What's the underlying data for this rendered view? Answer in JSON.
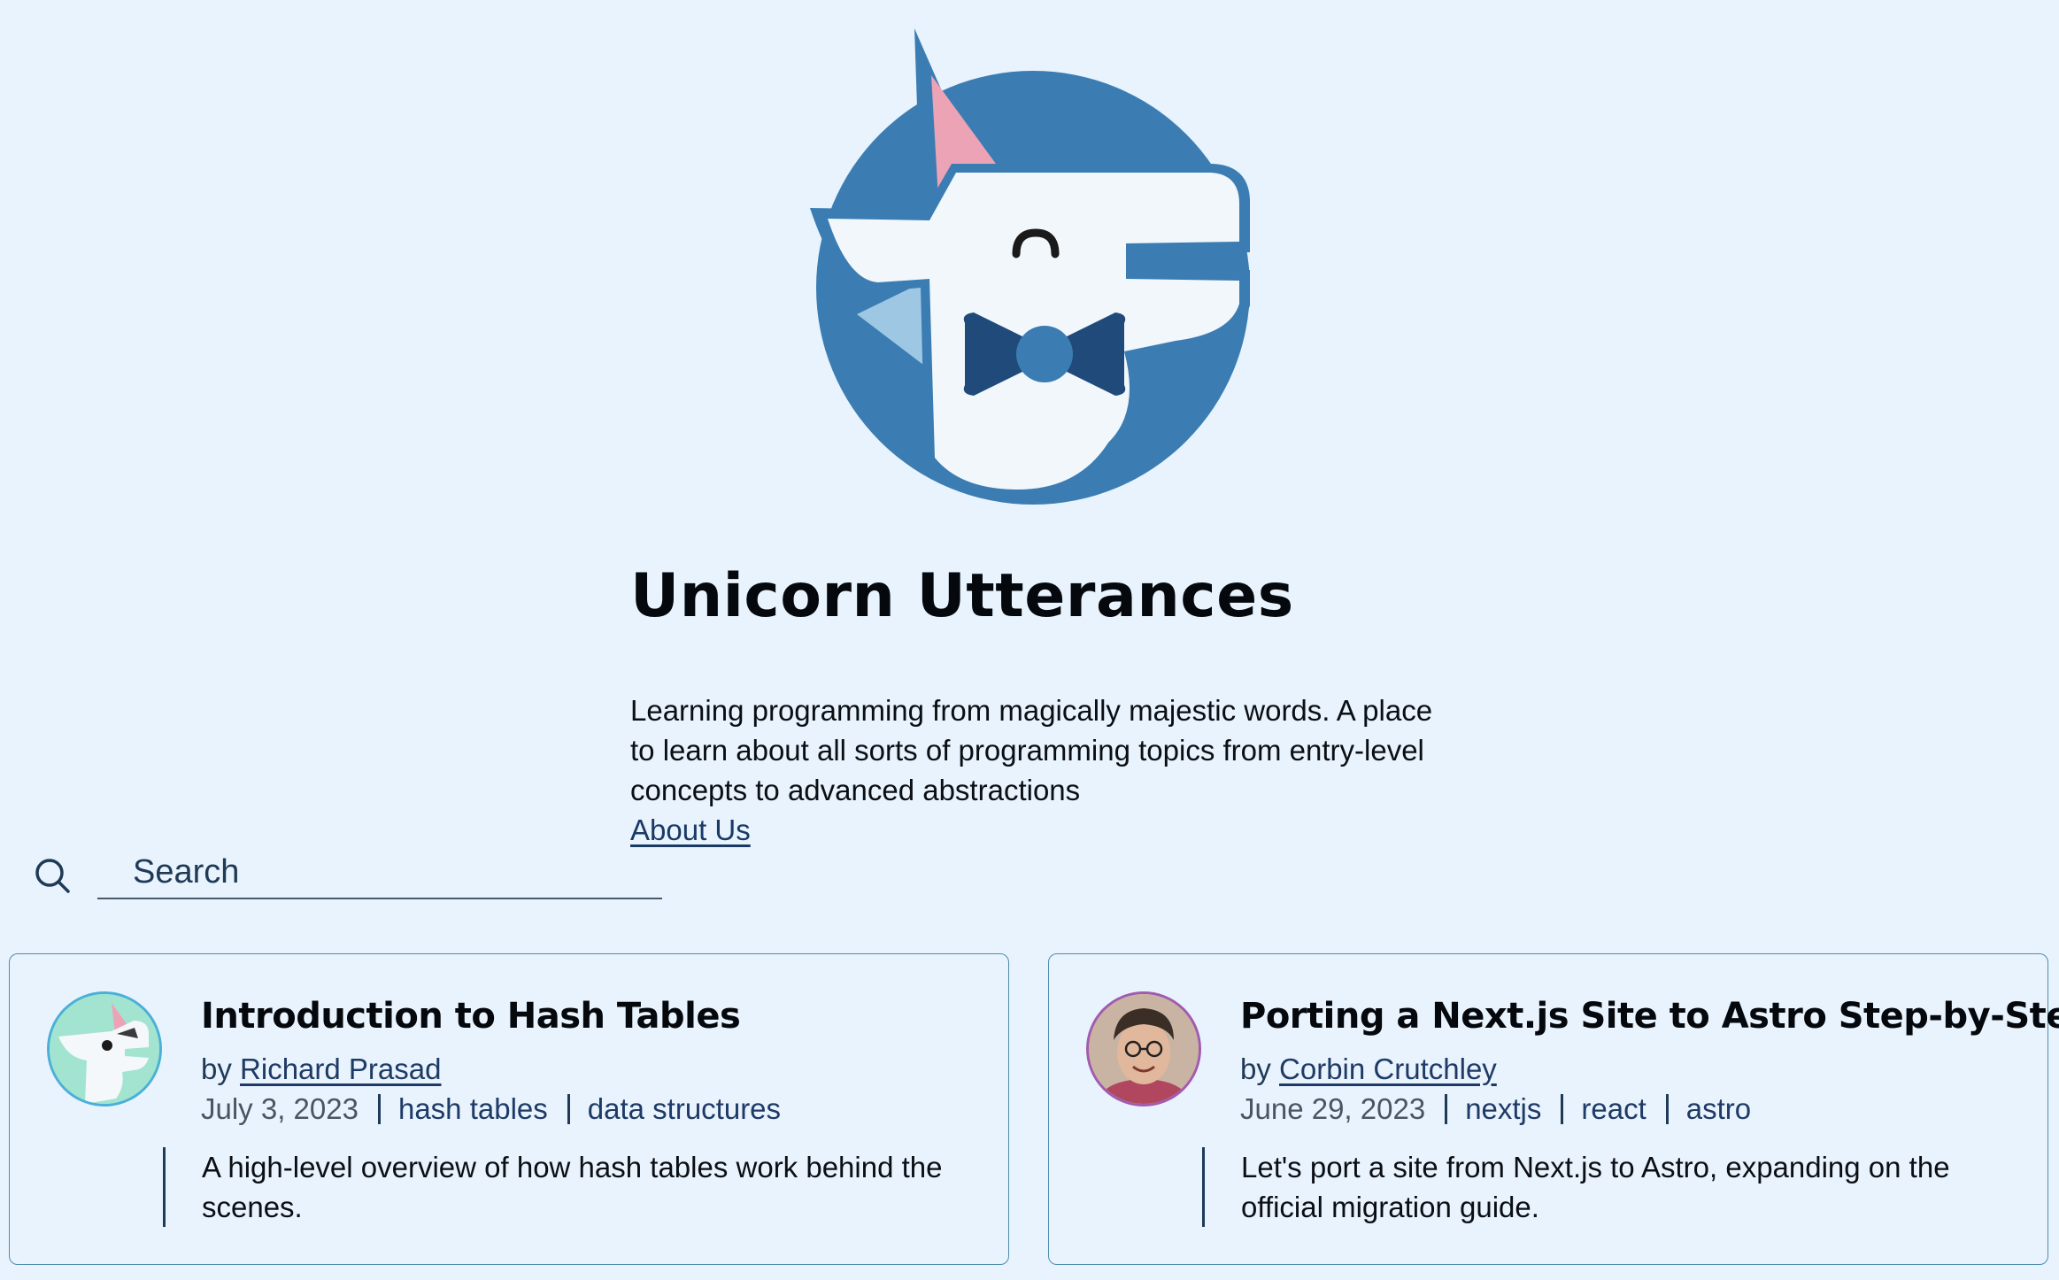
{
  "site": {
    "logo_icon": "unicorn-bowtie-logo",
    "title": "Unicorn Utterances",
    "tagline": "Learning programming from magically majestic words. A place to learn about all sorts of programming topics from entry-level concepts to advanced abstractions",
    "about_label": "About Us"
  },
  "search": {
    "icon": "search-icon",
    "placeholder": "Search",
    "value": ""
  },
  "posts": [
    {
      "title": "Introduction to Hash Tables",
      "by": "by",
      "author": "Richard Prasad",
      "date": "July 3, 2023",
      "tags": [
        "hash tables",
        "data structures"
      ],
      "description": "A high-level overview of how hash tables work behind the scenes.",
      "avatar_icon": "unicorn-avatar"
    },
    {
      "title": "Porting a Next.js Site to Astro Step-by-Step",
      "by": "by",
      "author": "Corbin Crutchley",
      "date": "June 29, 2023",
      "tags": [
        "nextjs",
        "react",
        "astro"
      ],
      "description": "Let's port a site from Next.js to Astro, expanding on the official migration guide.",
      "avatar_icon": "person-avatar"
    }
  ],
  "colors": {
    "background": "#e8f3fd",
    "logo_blue": "#3b7db2",
    "bowtie": "#1f4a7a",
    "card_border": "#4f8cae",
    "link": "#1e3a66"
  }
}
